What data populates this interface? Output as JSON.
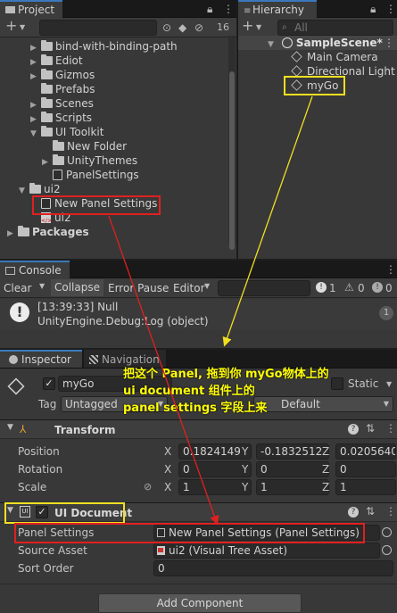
{
  "project": {
    "tab": "Project",
    "add": "+",
    "badge": "16",
    "tree": [
      {
        "label": "bind-with-binding-path",
        "type": "folder",
        "indent": 2,
        "fold": "▶"
      },
      {
        "label": "Ediot",
        "type": "folder",
        "indent": 2,
        "fold": "▶"
      },
      {
        "label": "Gizmos",
        "type": "folder",
        "indent": 2,
        "fold": "▶"
      },
      {
        "label": "Prefabs",
        "type": "folder",
        "indent": 2,
        "fold": ""
      },
      {
        "label": "Scenes",
        "type": "folder",
        "indent": 2,
        "fold": "▶"
      },
      {
        "label": "Scripts",
        "type": "folder",
        "indent": 2,
        "fold": "▶"
      },
      {
        "label": "UI Toolkit",
        "type": "folder",
        "indent": 2,
        "fold": "▼"
      },
      {
        "label": "New Folder",
        "type": "folder",
        "indent": 3,
        "fold": ""
      },
      {
        "label": "UnityThemes",
        "type": "folder",
        "indent": 3,
        "fold": "▶"
      },
      {
        "label": "PanelSettings",
        "type": "file",
        "indent": 3,
        "fold": ""
      },
      {
        "label": "ui2",
        "type": "folder",
        "indent": 1,
        "fold": "▼"
      },
      {
        "label": "New Panel Settings",
        "type": "file",
        "indent": 2,
        "fold": ""
      },
      {
        "label": "ui2",
        "type": "xml",
        "indent": 2,
        "fold": ""
      },
      {
        "label": "Packages",
        "type": "folder",
        "indent": 0,
        "fold": "▶"
      }
    ]
  },
  "hierarchy": {
    "tab": "Hierarchy",
    "search_placeholder": "All",
    "scene": "SampleScene*",
    "items": [
      "Main Camera",
      "Directional Light",
      "myGo"
    ]
  },
  "console": {
    "tab": "Console",
    "buttons": [
      "Clear",
      "Collapse",
      "Error Pause",
      "Editor"
    ],
    "counts": [
      "1",
      "0",
      "0"
    ],
    "log_line1": "[13:39:33] Null",
    "log_line2": "UnityEngine.Debug:Log (object)",
    "log_count": "1"
  },
  "inspector": {
    "tabs": [
      "Inspector",
      "Navigation"
    ],
    "object_name": "myGo",
    "static_label": "Static",
    "tag_label": "Tag",
    "tag_value": "Untagged",
    "layer_value": "Default",
    "transform": {
      "title": "Transform",
      "rows": [
        {
          "label": "Position",
          "x": "0.1824149",
          "y": "-0.1832512",
          "z": "0.0205640"
        },
        {
          "label": "Rotation",
          "x": "0",
          "y": "0",
          "z": "0"
        },
        {
          "label": "Scale",
          "x": "1",
          "y": "1",
          "z": "1"
        }
      ]
    },
    "ui_document": {
      "title": "UI Document",
      "panel_settings_label": "Panel Settings",
      "panel_settings_value": "New Panel Settings (Panel Settings)",
      "source_asset_label": "Source Asset",
      "source_asset_value": "ui2 (Visual Tree Asset)",
      "sort_order_label": "Sort Order",
      "sort_order_value": "0"
    },
    "add_component": "Add Component"
  },
  "annotation": {
    "lines": [
      "把这个 Panel, 拖到你 myGo物体上的",
      "ui document 组件上的",
      "panel settings 字段上来"
    ]
  },
  "colors": {
    "annotation": "#ffff00",
    "highlight_red": "#e02020",
    "highlight_yellow": "#f0e020",
    "accent": "#3a79bb"
  }
}
